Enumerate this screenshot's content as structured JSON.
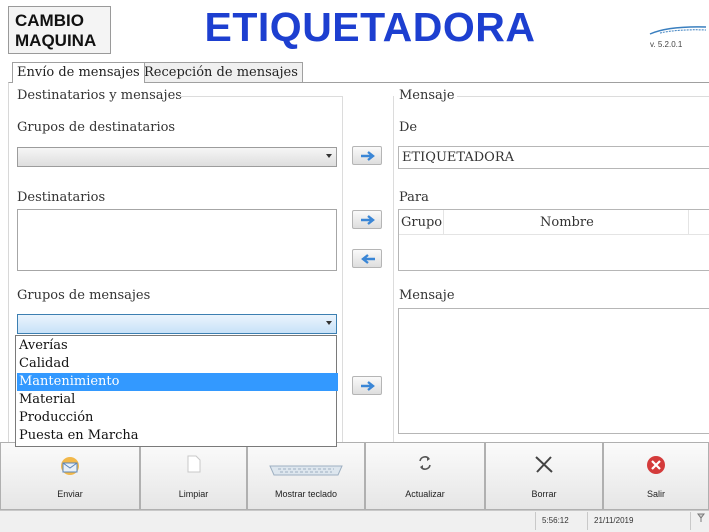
{
  "header": {
    "machine_button": "CAMBIO\nMAQUINA",
    "machine_line1": "CAMBIO",
    "machine_line2": "MAQUINA",
    "app_title": "ETIQUETADORA",
    "version": "v. 5.2.0.1"
  },
  "tabs": [
    {
      "label": "Envío de mensajes",
      "active": true
    },
    {
      "label": "Recepción de mensajes",
      "active": false
    }
  ],
  "left_panel": {
    "group_title": "Destinatarios y mensajes",
    "recipient_groups_label": "Grupos de destinatarios",
    "recipient_groups_value": "",
    "recipients_label": "Destinatarios",
    "message_groups_label": "Grupos de mensajes",
    "message_groups_value": "",
    "message_group_options": [
      "Averías",
      "Calidad",
      "Mantenimiento",
      "Material",
      "Producción",
      "Puesta en Marcha"
    ],
    "message_group_highlighted": "Mantenimiento"
  },
  "right_panel": {
    "group_title": "Mensaje",
    "from_label": "De",
    "from_value": "ETIQUETADORA",
    "to_label": "Para",
    "to_columns": [
      "Grupo",
      "Nombre"
    ],
    "message_label": "Mensaje",
    "message_value": ""
  },
  "toolbar": [
    {
      "label": "Enviar",
      "icon": "send-envelope-icon"
    },
    {
      "label": "Limpiar",
      "icon": "blank-page-icon"
    },
    {
      "label": "Mostrar teclado",
      "icon": "keyboard-icon"
    },
    {
      "label": "Actualizar",
      "icon": "refresh-icon"
    },
    {
      "label": "Borrar",
      "icon": "delete-x-icon"
    },
    {
      "label": "Salir",
      "icon": "exit-red-x-icon"
    }
  ],
  "status": {
    "time": "5:56:12",
    "date": "21/11/2019",
    "indicator_icon": "network-icon"
  },
  "colors": {
    "title": "#1d3fd0",
    "selection": "#3399ff",
    "exit": "#d43b3b"
  }
}
